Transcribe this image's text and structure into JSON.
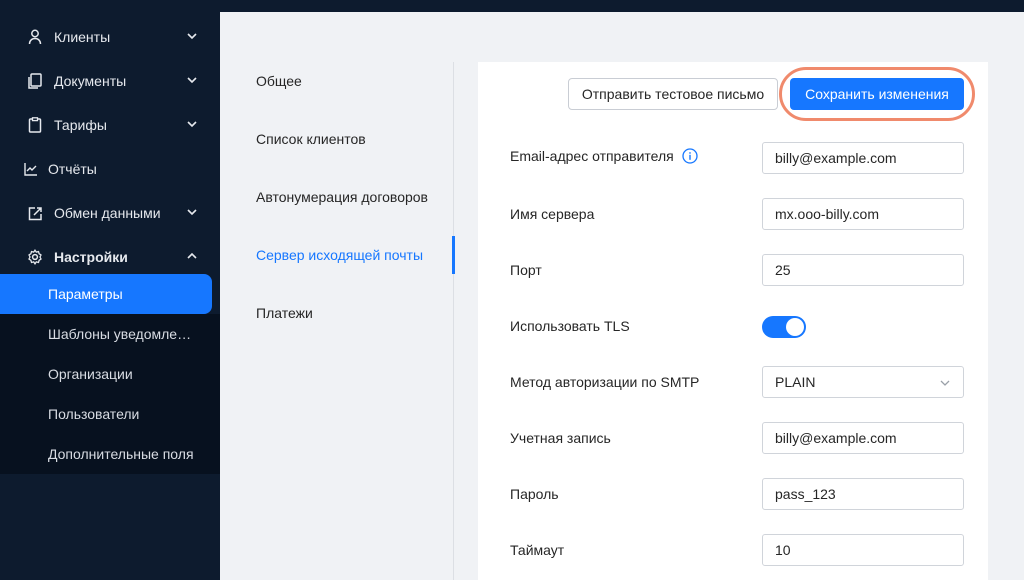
{
  "sidebar": {
    "items": [
      {
        "label": "Клиенты",
        "icon": "user-icon",
        "chevron": "down"
      },
      {
        "label": "Документы",
        "icon": "documents-icon",
        "chevron": "down"
      },
      {
        "label": "Тарифы",
        "icon": "tariff-icon",
        "chevron": "down"
      },
      {
        "label": "Отчёты",
        "icon": "chart-icon"
      },
      {
        "label": "Обмен данными",
        "icon": "exchange-icon",
        "chevron": "down"
      },
      {
        "label": "Настройки",
        "icon": "gear-icon",
        "chevron": "up"
      }
    ],
    "sub_items": [
      {
        "label": "Параметры",
        "active": true
      },
      {
        "label": "Шаблоны уведомлений"
      },
      {
        "label": "Организации"
      },
      {
        "label": "Пользователи"
      },
      {
        "label": "Дополнительные поля"
      }
    ]
  },
  "tabs": [
    {
      "label": "Общее"
    },
    {
      "label": "Список клиентов"
    },
    {
      "label": "Автонумерация договоров"
    },
    {
      "label": "Сервер исходящей почты",
      "active": true
    },
    {
      "label": "Платежи"
    }
  ],
  "toolbar": {
    "test_label": "Отправить тестовое письмо",
    "save_label": "Сохранить изменения"
  },
  "form": {
    "sender_email": {
      "label": "Email-адрес отправителя",
      "value": "billy@example.com"
    },
    "server_name": {
      "label": "Имя сервера",
      "value": "mx.ooo-billy.com"
    },
    "port": {
      "label": "Порт",
      "value": "25"
    },
    "use_tls": {
      "label": "Использовать TLS",
      "enabled": true
    },
    "smtp_auth": {
      "label": "Метод авторизации по SMTP",
      "value": "PLAIN"
    },
    "account": {
      "label": "Учетная запись",
      "value": "billy@example.com"
    },
    "password": {
      "label": "Пароль",
      "value": "pass_123"
    },
    "timeout": {
      "label": "Таймаут",
      "value": "10"
    }
  },
  "colors": {
    "sidebar_bg": "#0d1b2e",
    "accent": "#1677ff",
    "highlight_ring": "#f08a6c"
  }
}
